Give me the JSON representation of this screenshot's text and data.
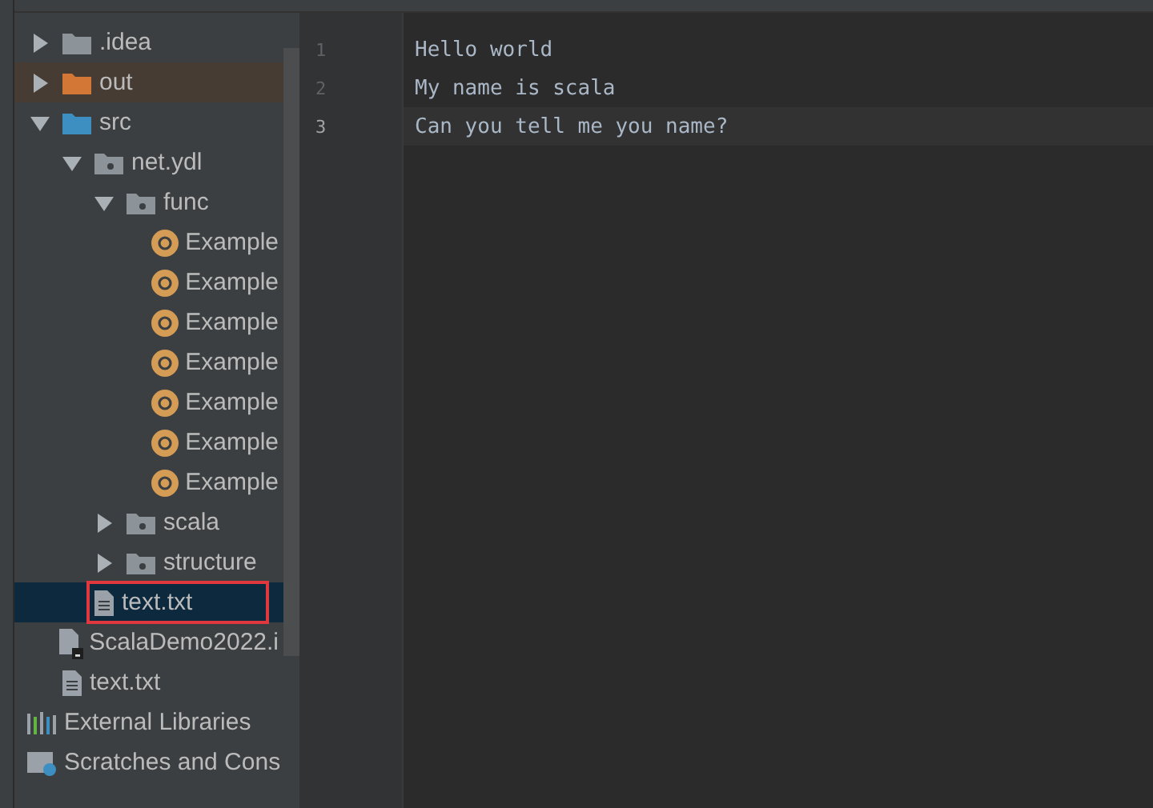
{
  "project_tree": {
    "items": [
      {
        "label": ".idea",
        "kind": "folder",
        "expanded": false,
        "selected": false,
        "highlighted": false
      },
      {
        "label": "out",
        "kind": "output-folder",
        "expanded": false,
        "selected": false,
        "highlighted": true
      },
      {
        "label": "src",
        "kind": "source-folder",
        "expanded": true,
        "selected": false,
        "highlighted": false,
        "children": [
          {
            "label": "net.ydl",
            "kind": "package",
            "expanded": true,
            "selected": false,
            "highlighted": false,
            "children": [
              {
                "label": "func",
                "kind": "package",
                "expanded": true,
                "selected": false,
                "highlighted": false,
                "children": [
                  {
                    "label": "Example",
                    "kind": "scala-object",
                    "selected": false,
                    "highlighted": false
                  },
                  {
                    "label": "Example",
                    "kind": "scala-object",
                    "selected": false,
                    "highlighted": false
                  },
                  {
                    "label": "Example",
                    "kind": "scala-object",
                    "selected": false,
                    "highlighted": false
                  },
                  {
                    "label": "Example",
                    "kind": "scala-object",
                    "selected": false,
                    "highlighted": false
                  },
                  {
                    "label": "Example",
                    "kind": "scala-object",
                    "selected": false,
                    "highlighted": false
                  },
                  {
                    "label": "Example",
                    "kind": "scala-object",
                    "selected": false,
                    "highlighted": false
                  },
                  {
                    "label": "Example",
                    "kind": "scala-object",
                    "selected": false,
                    "highlighted": false
                  }
                ]
              },
              {
                "label": "scala",
                "kind": "package",
                "expanded": false,
                "selected": false,
                "highlighted": false
              },
              {
                "label": "structure",
                "kind": "package",
                "expanded": false,
                "selected": false,
                "highlighted": false
              }
            ]
          },
          {
            "label": "text.txt",
            "kind": "text-file",
            "selected": true,
            "highlighted": false
          }
        ]
      },
      {
        "label": "ScalaDemo2022.i",
        "kind": "module-file",
        "selected": false,
        "highlighted": false
      },
      {
        "label": "text.txt",
        "kind": "text-file",
        "selected": false,
        "highlighted": false
      },
      {
        "label": "External Libraries",
        "kind": "libraries",
        "selected": false,
        "highlighted": false
      },
      {
        "label": "Scratches and Cons",
        "kind": "scratches",
        "selected": false,
        "highlighted": false
      }
    ]
  },
  "editor": {
    "lines": [
      {
        "number": "1",
        "text": "Hello world",
        "current": false
      },
      {
        "number": "2",
        "text": "My name is scala",
        "current": false
      },
      {
        "number": "3",
        "text": "Can you tell me you name?",
        "current": true
      }
    ]
  }
}
